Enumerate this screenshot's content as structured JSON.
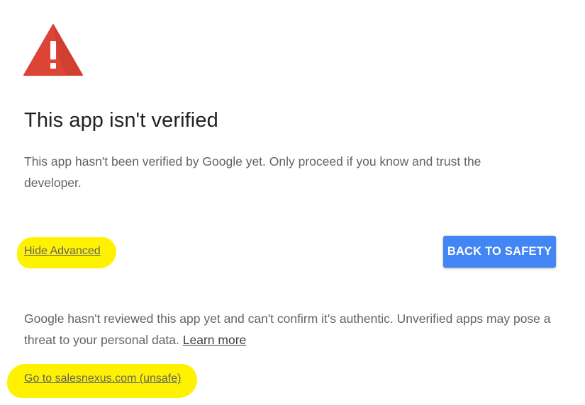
{
  "icon": "warning-triangle-icon",
  "colors": {
    "warning_red": "#db4437",
    "button_blue": "#4285f4",
    "highlight_yellow": "#fff200",
    "body_text": "#5f6368"
  },
  "title": "This app isn't verified",
  "description": "This app hasn't been verified by Google yet. Only proceed if you know and trust the developer.",
  "advanced_link": "Hide Advanced",
  "back_button": "BACK TO SAFETY",
  "details": {
    "text": "Google hasn't reviewed this app yet and can't confirm it's authentic. Unverified apps may pose a threat to your personal data.",
    "learn_more": "Learn more"
  },
  "proceed_link": "Go to salesnexus.com (unsafe)"
}
